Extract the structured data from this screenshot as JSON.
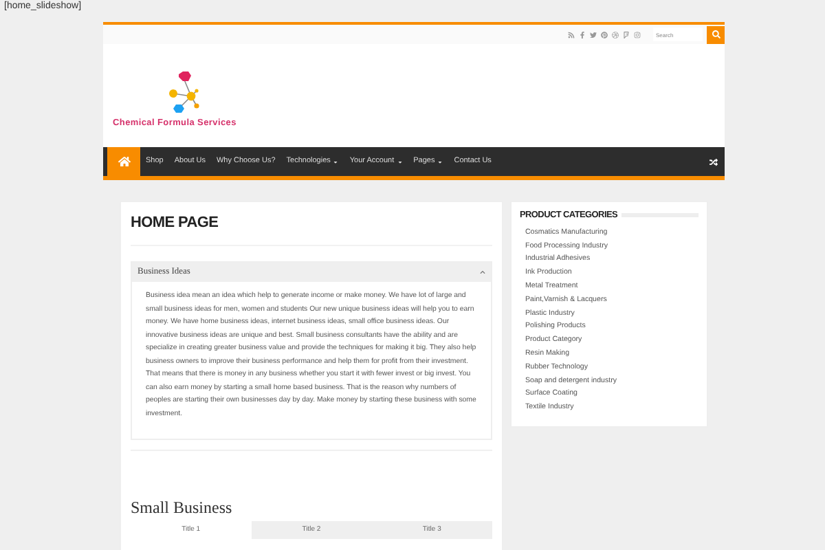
{
  "shortcode": "[home_slideshow]",
  "search": {
    "placeholder": "Search"
  },
  "logo": {
    "text": "Chemical Formula Services"
  },
  "nav": {
    "items": [
      {
        "label": "Shop",
        "dropdown": false
      },
      {
        "label": "About Us",
        "dropdown": false
      },
      {
        "label": "Why Choose Us?",
        "dropdown": false
      },
      {
        "label": "Technologies",
        "dropdown": true
      },
      {
        "label": "Your Account",
        "dropdown": true
      },
      {
        "label": "Pages",
        "dropdown": true
      },
      {
        "label": "Contact Us",
        "dropdown": false
      }
    ]
  },
  "main": {
    "title": "HOME PAGE",
    "accordion": {
      "title": "Business Ideas",
      "expanded": true,
      "body": "Business idea mean an idea which help to generate income or make money. We have lot of large and small business ideas for men, women and students Our new unique business ideas will help you to earn money. We have home business ideas, internet business ideas, small office business ideas. Our innovative business ideas are unique and best. Small business consultants have the ability and are specialize in creating greater business value and provide the techniques for making it big. They also help business owners to improve their business performance and help them for profit from their investment. That means that there is money in any business whether you start it with fewer invest or big invest. You can also earn money by starting a small home based business. That is the reason why numbers of peoples are starting their own businesses day by day. Make money by starting these business with some investment."
    },
    "section_title": "Small Business",
    "tabs": [
      {
        "label": "Title 1",
        "selected": true
      },
      {
        "label": "Title 2",
        "selected": false
      },
      {
        "label": "Title 3",
        "selected": false
      }
    ]
  },
  "sidebar": {
    "title": "PRODUCT CATEGORIES",
    "items": [
      "Cosmatics Manufacturing",
      "Food Processing Industry",
      "Industrial Adhesives",
      "Ink Production",
      "Metal Treatment",
      "Paint,Varnish & Lacquers",
      "Plastic Industry",
      "Polishing Products",
      "Product Category",
      "Resin Making",
      "Rubber Technology",
      "Soap and detergent industry",
      "Surface Coating",
      "Textile Industry"
    ]
  }
}
